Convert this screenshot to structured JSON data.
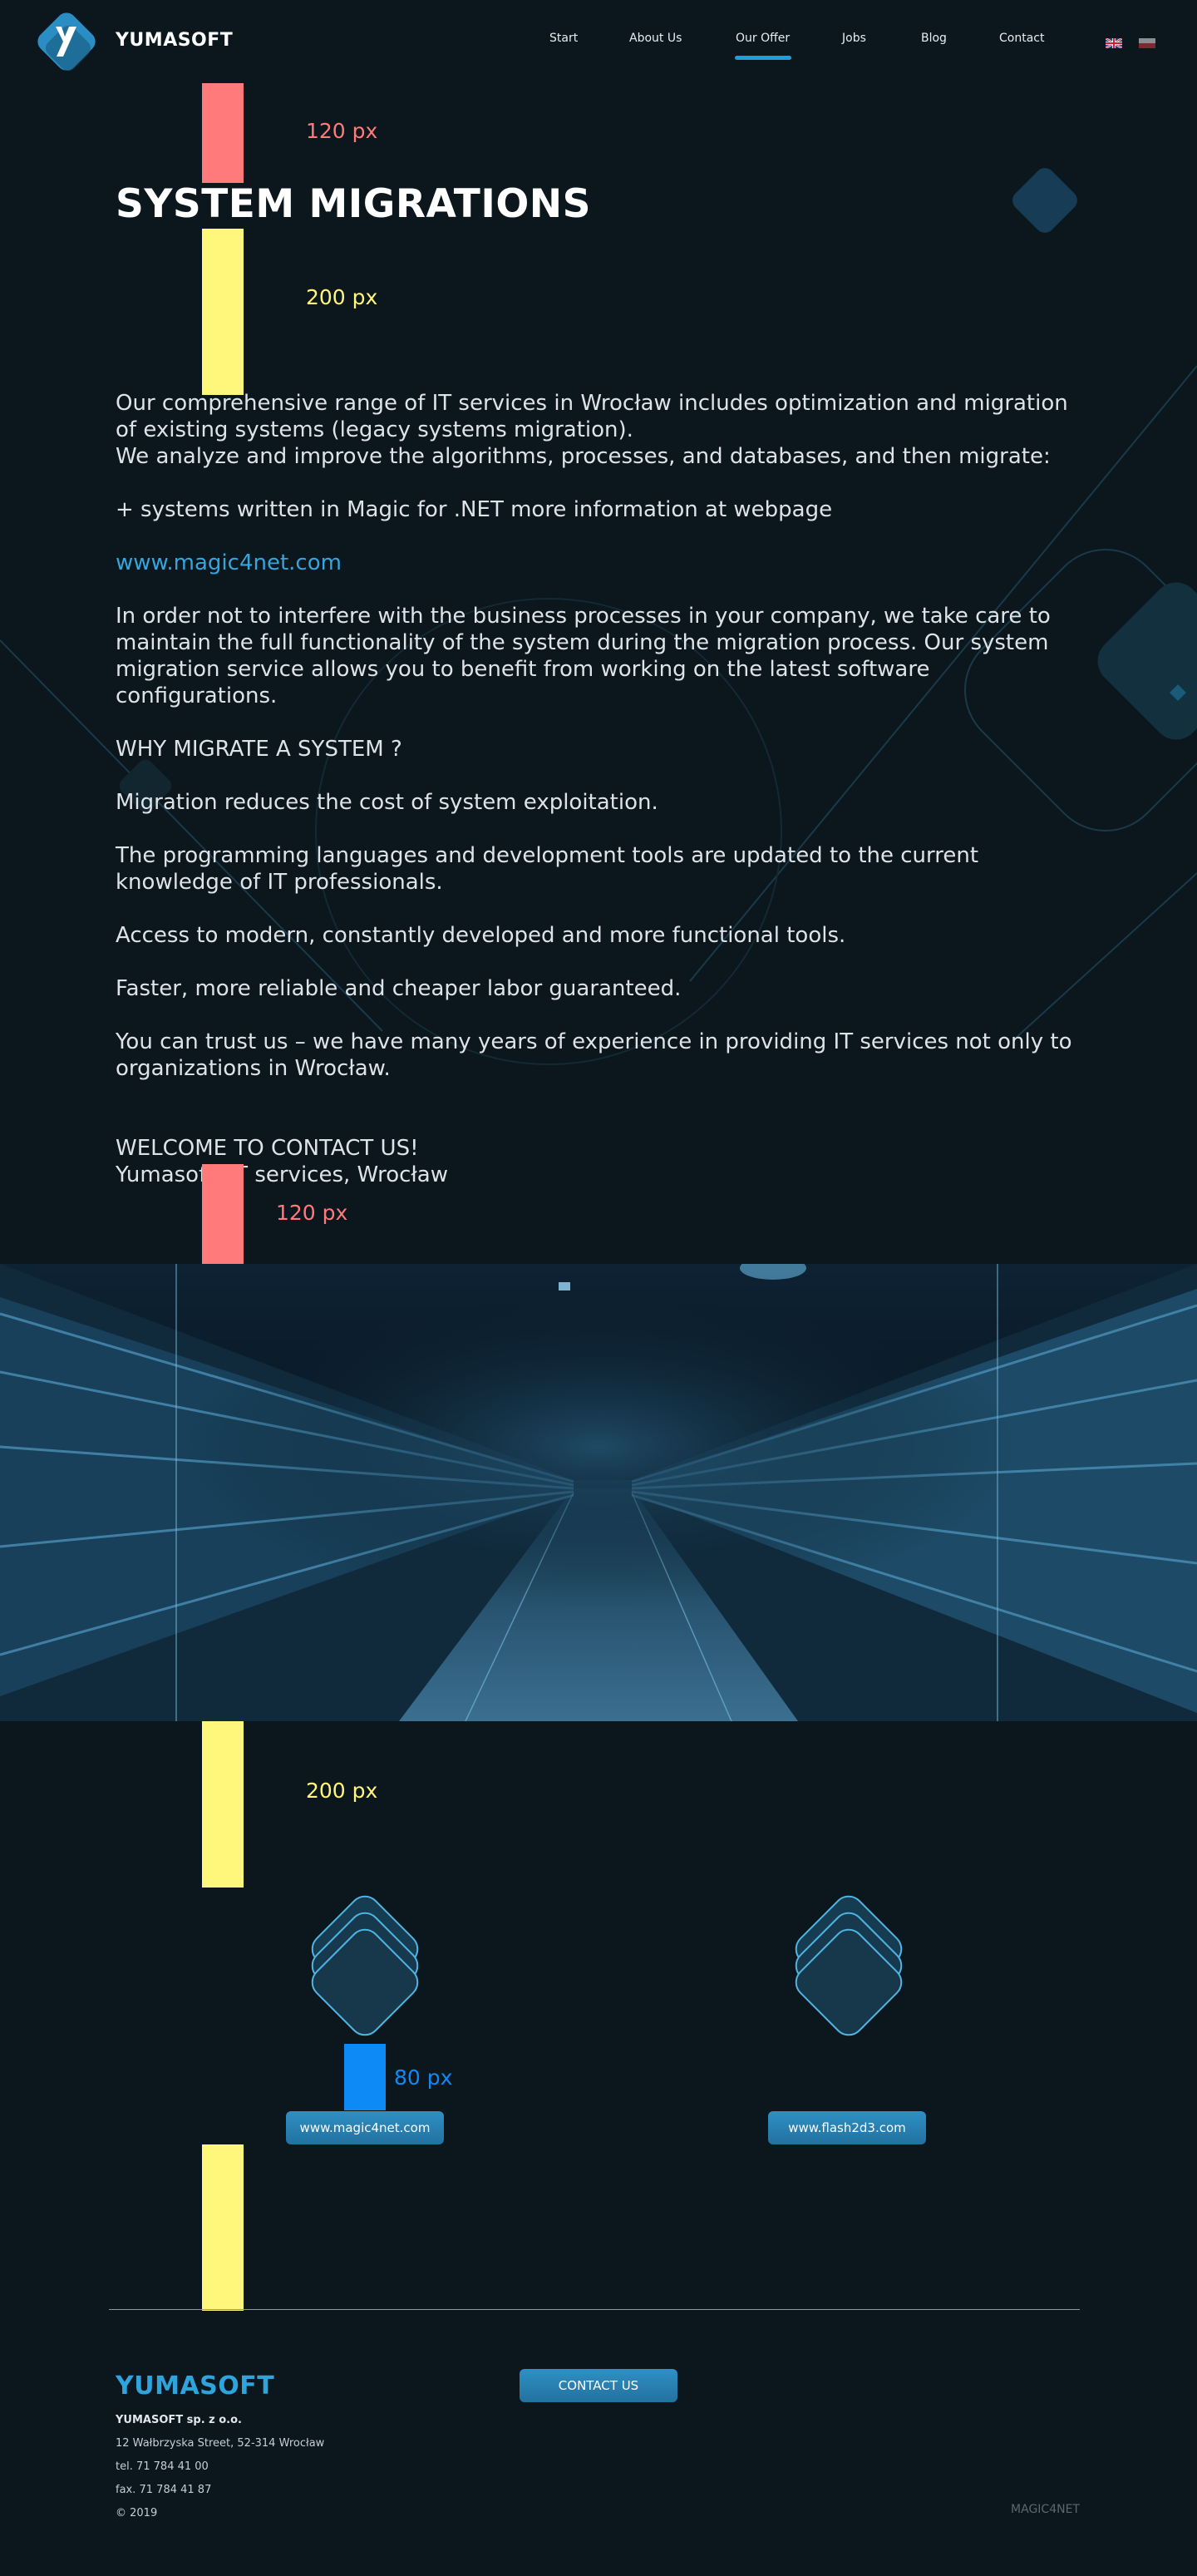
{
  "header": {
    "brand": "YUMASOFT",
    "nav": [
      {
        "label": "Start"
      },
      {
        "label": "About Us"
      },
      {
        "label": "Our Offer",
        "active": true
      },
      {
        "label": "Jobs"
      },
      {
        "label": "Blog"
      },
      {
        "label": "Contact"
      }
    ],
    "languages": [
      "en",
      "pl"
    ]
  },
  "markers": {
    "m1": "120 px",
    "m2": "200 px",
    "m3": "120 px",
    "m4": "200 px",
    "m5": "80 px"
  },
  "main": {
    "title": "SYSTEM MIGRATIONS",
    "paragraphs": {
      "intro1": "Our comprehensive range of IT services in Wrocław includes optimization and migration of existing systems (legacy systems migration).",
      "intro2": "We analyze and improve the algorithms, processes, and databases, and then migrate:",
      "magic": "+ systems written in Magic for .NET more information at webpage",
      "link": "www.magic4net.com",
      "process": "In order not to interfere with the business processes in your company, we take care to maintain the full functionality of the system during the migration process. Our system migration service allows you to benefit from working on the latest software configurations.",
      "why": "WHY MIGRATE A SYSTEM ?",
      "cost": "Migration reduces the cost of system exploitation.",
      "languages": "The programming languages and development tools are updated to the current knowledge of IT professionals.",
      "tools": "Access to modern, constantly developed and more functional tools.",
      "labor": "Faster, more reliable and cheaper labor guaranteed.",
      "trust": "You can trust us – we have many years of experience in providing IT services not only to organizations in Wrocław.",
      "welcome": "WELCOME TO CONTACT US!",
      "signature": "Yumasoft, IT services, Wrocław"
    }
  },
  "partners": [
    {
      "label": "www.magic4net.com"
    },
    {
      "label": "www.flash2d3.com"
    }
  ],
  "footer": {
    "brand": "YUMASOFT",
    "company": "YUMASOFT sp. z o.o.",
    "address": "12 Wałbrzyska Street, 52-314 Wrocław",
    "tel": "tel. 71 784 41 00",
    "fax": "fax. 71 784 41 87",
    "copyright": "© 2019",
    "contact_button": "CONTACT US",
    "credit": "MAGIC4NET"
  },
  "colors": {
    "background": "#0c161d",
    "accent": "#2ea3dc",
    "marker_red": "#ff7b7b",
    "marker_yellow": "#fff67c",
    "marker_blue": "#0e8af7"
  }
}
